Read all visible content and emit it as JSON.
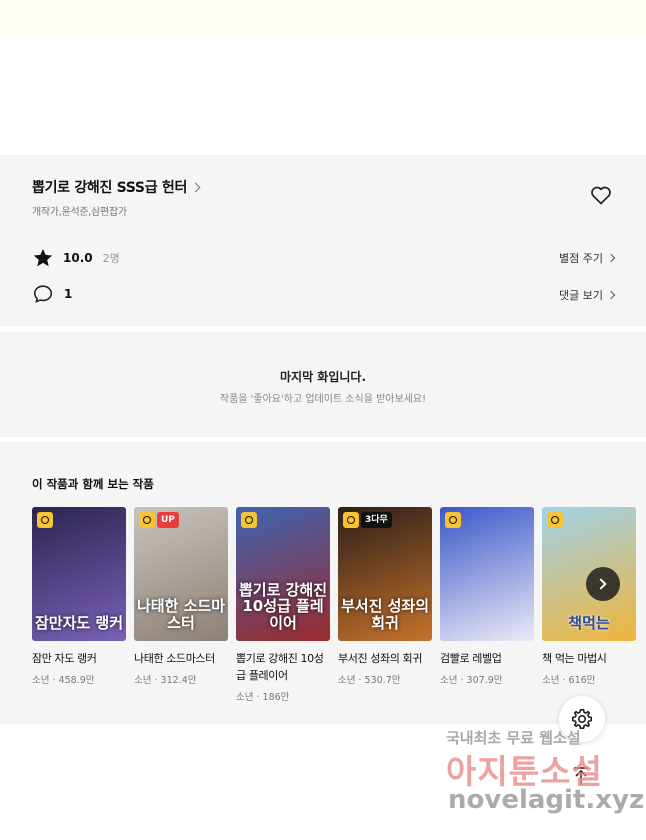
{
  "work": {
    "title": "뽑기로 강해진 SSS급 헌터",
    "authors": "개작가,윤석준,삼편잡가",
    "rating": "10.0",
    "rating_count": "2명",
    "comment_count": "1",
    "rate_link": "별점 주기",
    "comment_link": "댓글 보기"
  },
  "end_notice": {
    "title": "마지막 화입니다.",
    "subtitle": "작품을 '좋아요'하고 업데이트 소식을 받아보세요!"
  },
  "recommend": {
    "heading": "이 작품과 함께 보는 작품",
    "items": [
      {
        "title": "잠만 자도 랭커",
        "genre": "소년",
        "views": "458.9만",
        "badge": "",
        "cover_text": "잠만자도 랭커",
        "color_a": "#2c2450",
        "color_b": "#7a62b8"
      },
      {
        "title": "나태한 소드마스터",
        "genre": "소년",
        "views": "312.4만",
        "badge": "UP",
        "cover_text": "나태한 소드마스터",
        "color_a": "#c8c2bd",
        "color_b": "#8d8177"
      },
      {
        "title": "뽑기로 강해진 10성급 플레이어",
        "genre": "소년",
        "views": "186만",
        "badge": "",
        "cover_text": "뽑기로 강해진 10성급 플레이어",
        "color_a": "#3e64b2",
        "color_b": "#9c2b2b"
      },
      {
        "title": "부서진 성좌의 회귀",
        "genre": "소년",
        "views": "530.7만",
        "badge": "3다무",
        "cover_text": "부서진 성좌의 회귀",
        "color_a": "#2b1f1a",
        "color_b": "#c7722a"
      },
      {
        "title": "검빨로 레벨업",
        "genre": "소년",
        "views": "307.9만",
        "badge": "",
        "cover_text": "",
        "color_a": "#3a58c9",
        "color_b": "#ece9f6"
      },
      {
        "title": "책 먹는 마법시",
        "genre": "소년",
        "views": "616만",
        "badge": "",
        "cover_text": "책먹는",
        "color_a": "#9fd2ea",
        "color_b": "#f0b43a"
      }
    ]
  },
  "watermark": {
    "line1": "국내최초 무료 웹소설",
    "line2": "아지툰소설",
    "line3": "novelagit.xyz"
  },
  "colors": {
    "panel": "#f5f5f5",
    "top_band": "#fffef4",
    "clock_badge": "#f7c331",
    "up_badge": "#e83d3d"
  }
}
